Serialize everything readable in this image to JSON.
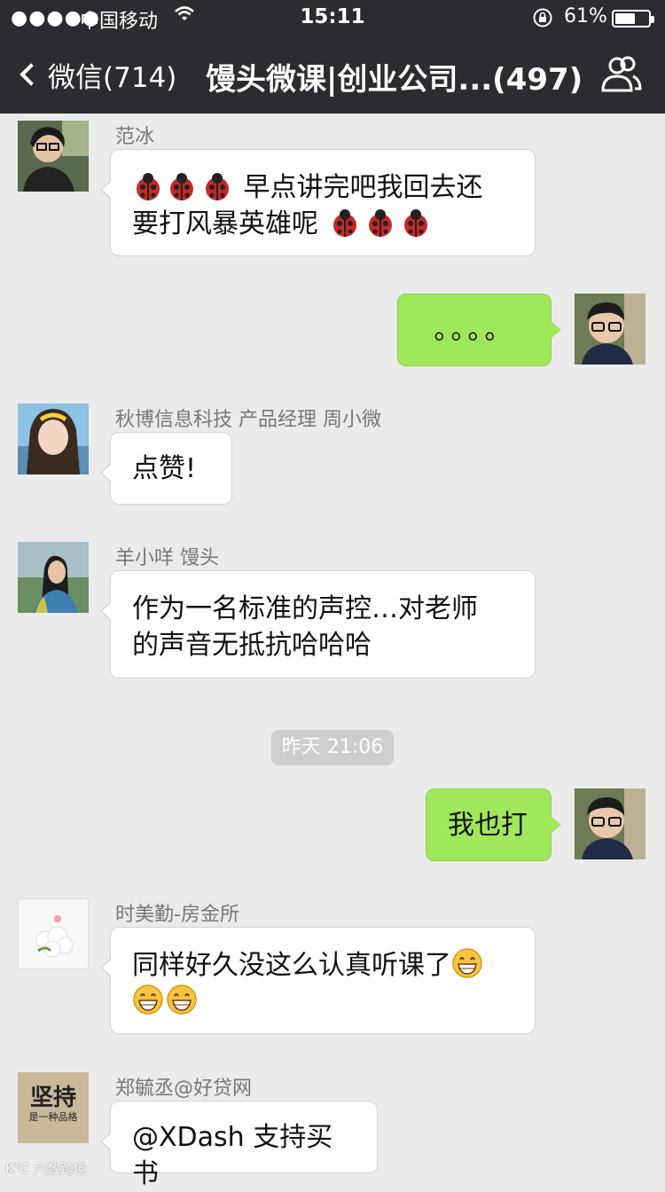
{
  "status_bar": {
    "signal": "●●●●●",
    "carrier": "中国移动",
    "time": "15:11",
    "battery_percent": "61%",
    "battery_level": 0.61
  },
  "nav": {
    "back_label": "微信(714)",
    "title": "馒头微课|创业公司...(497)",
    "people_icon": "people-icon"
  },
  "messages": [
    {
      "side": "left",
      "sender": "范冰",
      "line1": "早点讲完吧我回去还",
      "line2": "要打风暴英雄呢",
      "emoji": "ladybug"
    },
    {
      "side": "right",
      "text": "。。。。"
    },
    {
      "side": "left",
      "sender": "秋博信息科技 产品经理 周小微",
      "text": "点赞!"
    },
    {
      "side": "left",
      "sender": "羊小咩  馒头",
      "line1": "作为一名标准的声控…对老师",
      "line2": "的声音无抵抗哈哈哈"
    },
    {
      "timestamp": "昨天 21:06"
    },
    {
      "side": "right",
      "text": "我也打"
    },
    {
      "side": "left",
      "sender": "时美勤-房金所",
      "line1": "同样好久没这么认真听课了",
      "emoji": "grin"
    },
    {
      "side": "left",
      "sender": "郑毓丞@好贷网",
      "text": "@XDash 支持买书"
    }
  ],
  "avatar_jianchi": {
    "big": "坚持",
    "small": "是一种品格"
  },
  "watermark": "K℃ 六数跨境",
  "colors": {
    "topbar": "#2b2c30",
    "chat_bg": "#ebebeb",
    "bubble_self": "#a0e75a",
    "bubble_other": "#ffffff",
    "timestamp_bg": "#cecece"
  }
}
